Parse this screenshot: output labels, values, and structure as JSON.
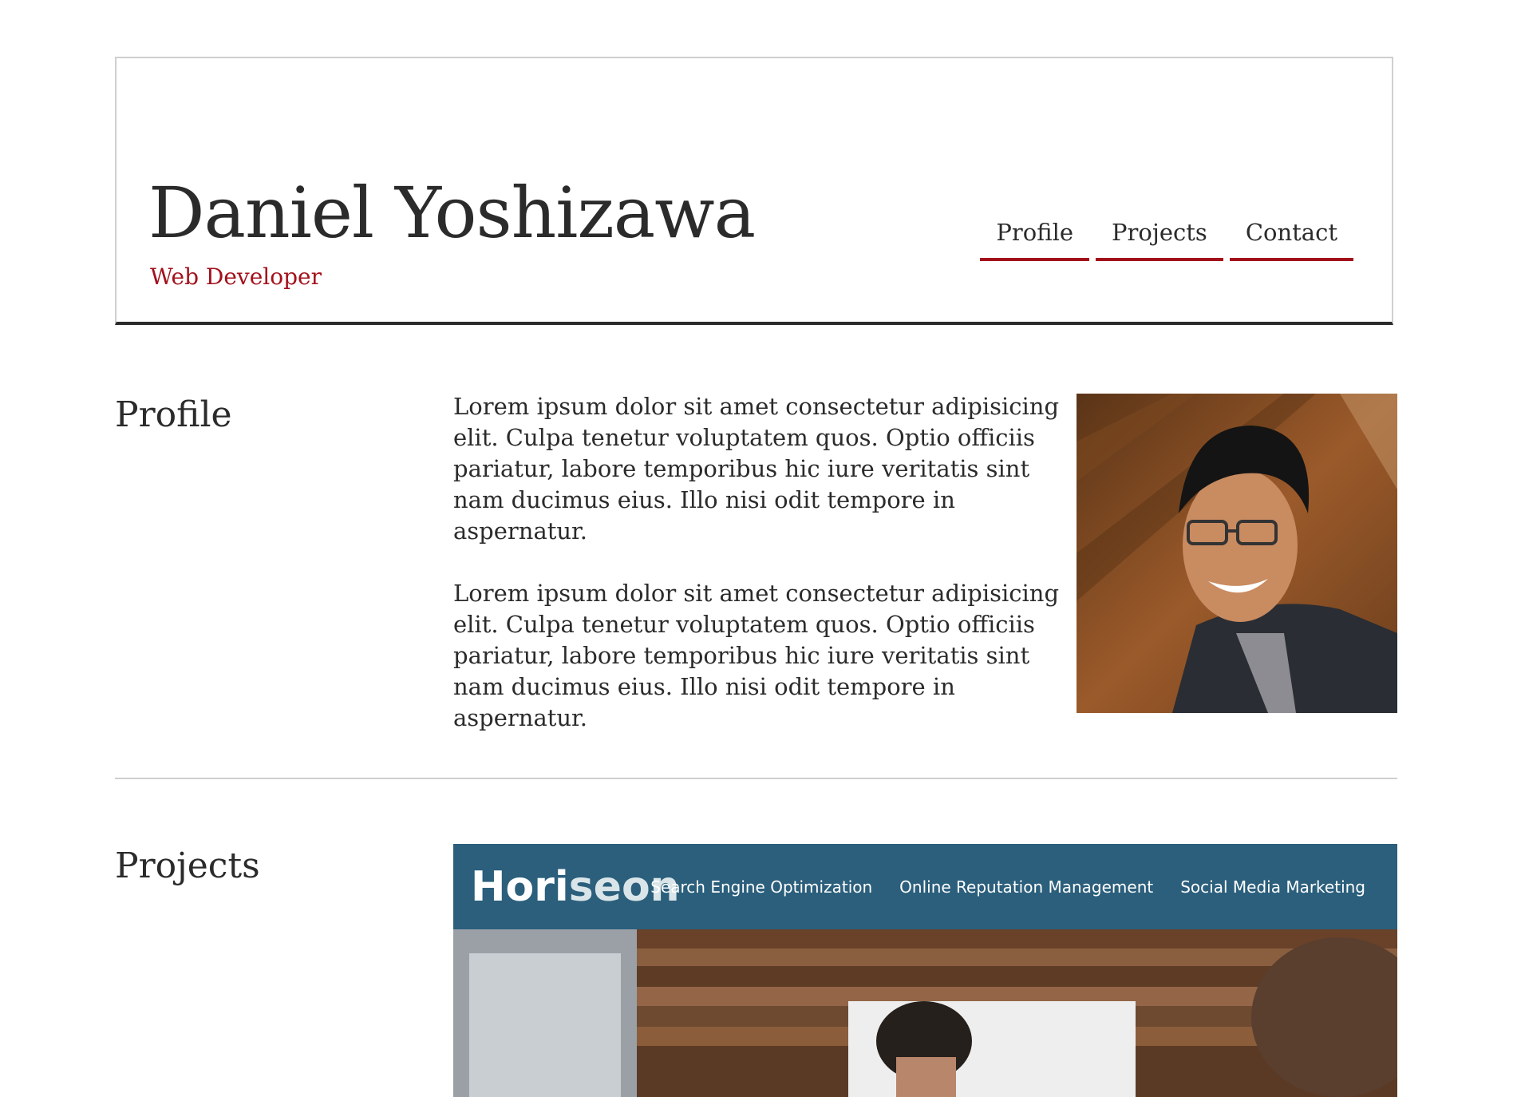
{
  "header": {
    "name": "Daniel Yoshizawa",
    "role": "Web Developer",
    "nav": [
      {
        "label": "Profile"
      },
      {
        "label": "Projects"
      },
      {
        "label": "Contact"
      }
    ]
  },
  "profile": {
    "title": "Profile",
    "paragraphs": [
      "Lorem ipsum dolor sit amet consectetur adipisicing elit. Culpa tenetur voluptatem quos. Optio officiis pariatur, labore temporibus hic iure veritatis sint nam ducimus eius. Illo nisi odit tempore in aspernatur.",
      "Lorem ipsum dolor sit amet consectetur adipisicing elit. Culpa tenetur voluptatem quos. Optio officiis pariatur, labore temporibus hic iure veritatis sint nam ducimus eius. Illo nisi odit tempore in aspernatur."
    ]
  },
  "projects": {
    "title": "Projects",
    "card": {
      "logo_main": "Hori",
      "logo_accent": "seon",
      "links": [
        "Search Engine Optimization",
        "Online Reputation Management",
        "Social Media Marketing"
      ]
    }
  },
  "colors": {
    "accent": "#a3111b",
    "text": "#2b2b2b",
    "project_bar": "#2b5f7c"
  }
}
